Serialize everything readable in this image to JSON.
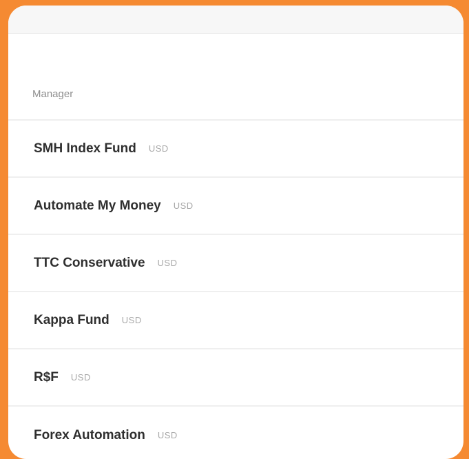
{
  "table": {
    "header": "Manager",
    "rows": [
      {
        "name": "SMH Index Fund",
        "currency": "USD"
      },
      {
        "name": "Automate My Money",
        "currency": "USD"
      },
      {
        "name": "TTC Conservative",
        "currency": "USD"
      },
      {
        "name": "Kappa Fund",
        "currency": "USD"
      },
      {
        "name": "R$F",
        "currency": "USD"
      },
      {
        "name": "Forex Automation",
        "currency": "USD"
      }
    ]
  },
  "colors": {
    "frame": "#f58a32",
    "card": "#ffffff",
    "name_text": "#2f2f2f",
    "muted_text": "#a8a8a8"
  }
}
